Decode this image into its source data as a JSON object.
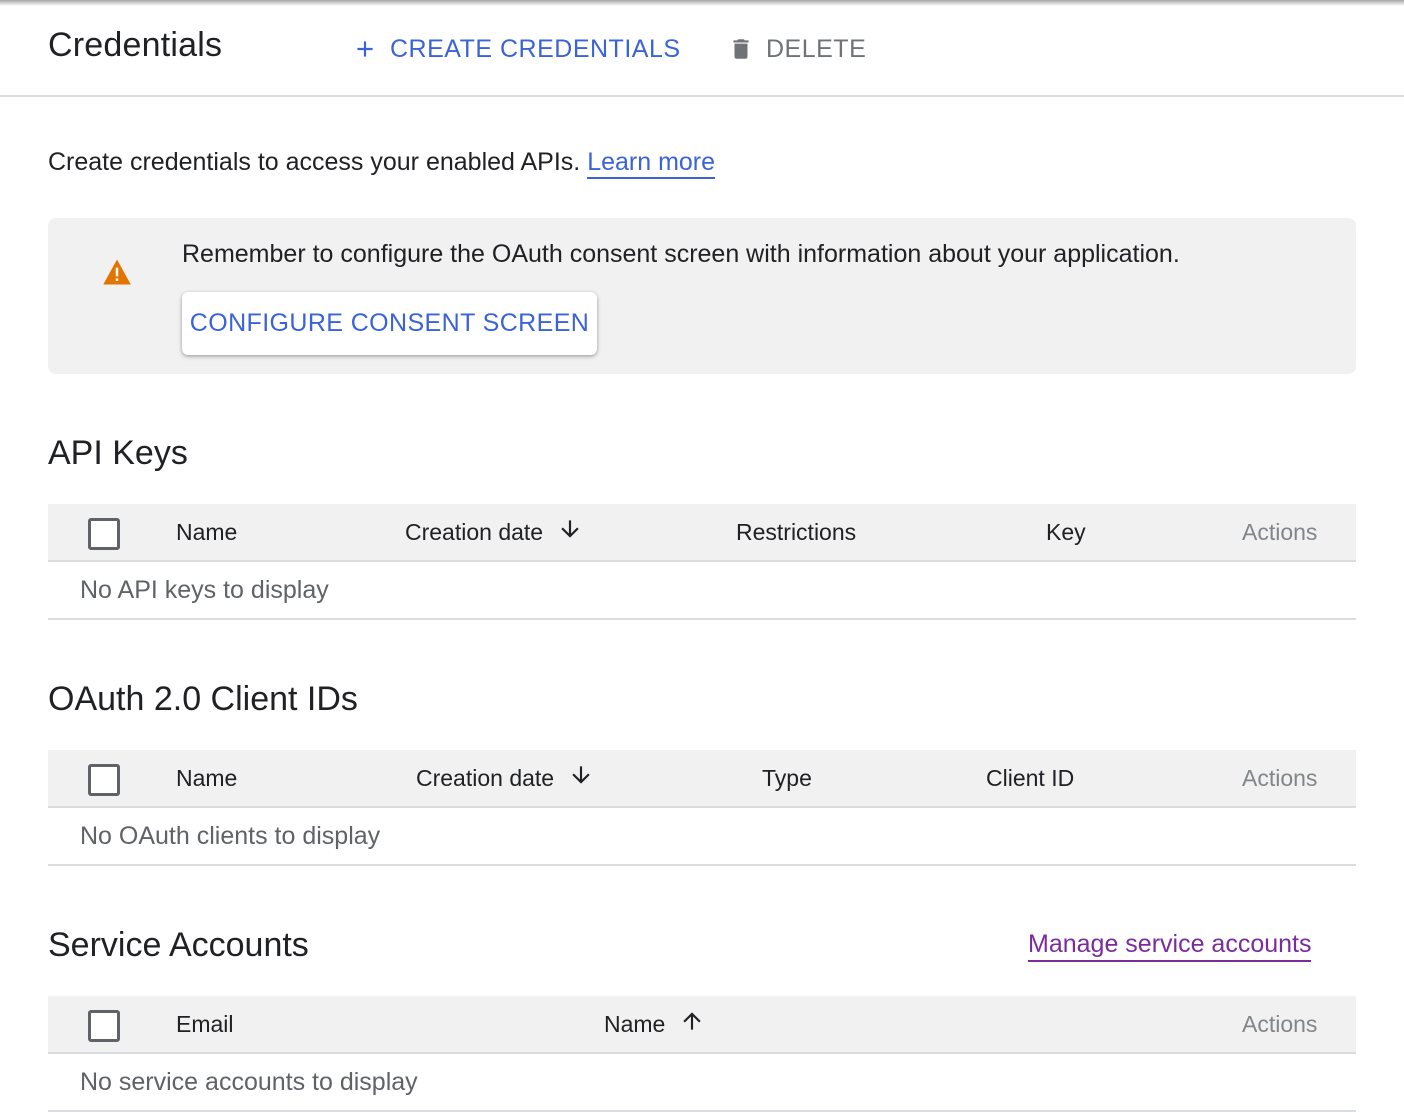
{
  "header": {
    "title": "Credentials",
    "create_label": "CREATE CREDENTIALS",
    "delete_label": "DELETE"
  },
  "intro": {
    "text": "Create credentials to access your enabled APIs. ",
    "link_label": "Learn more"
  },
  "notice": {
    "text": "Remember to configure the OAuth consent screen with information about your application.",
    "button_label": "CONFIGURE CONSENT SCREEN"
  },
  "api_keys": {
    "title": "API Keys",
    "columns": [
      "Name",
      "Creation date",
      "Restrictions",
      "Key",
      "Actions"
    ],
    "empty_text": "No API keys to display"
  },
  "oauth": {
    "title": "OAuth 2.0 Client IDs",
    "columns": [
      "Name",
      "Creation date",
      "Type",
      "Client ID",
      "Actions"
    ],
    "empty_text": "No OAuth clients to display"
  },
  "service_accounts": {
    "title": "Service Accounts",
    "manage_link": "Manage service accounts",
    "columns": [
      "Email",
      "Name",
      "Actions"
    ],
    "empty_text": "No service accounts to display"
  },
  "colors": {
    "accent_blue": "#3b63d9",
    "visited_link": "#7b2b9e",
    "warning_orange": "#e37400",
    "panel_gray": "#f1f1f1"
  },
  "icons": {
    "create": "plus-icon",
    "delete": "trash-icon",
    "warning": "warning-icon",
    "sort_desc": "arrow-down-icon",
    "sort_asc": "arrow-up-icon"
  }
}
